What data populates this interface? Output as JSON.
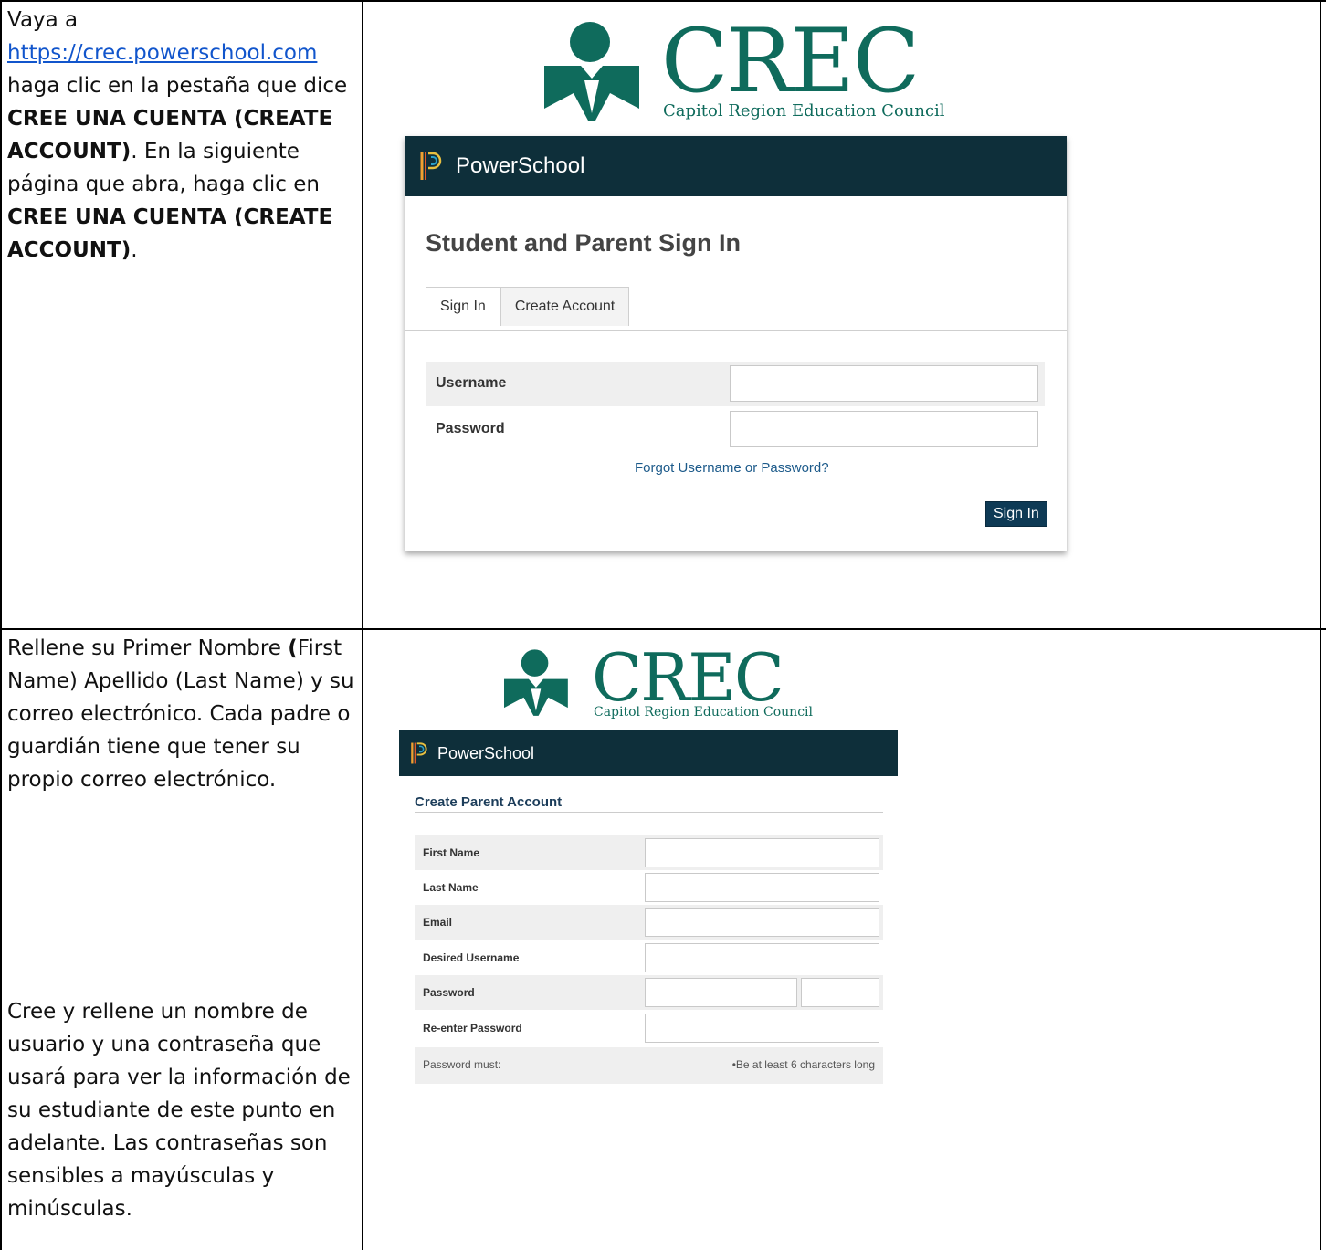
{
  "row1": {
    "instruction": {
      "prefix": "Vaya a",
      "link": "https://crec.powerschool.com",
      "text1": " haga clic en la pestaña que dice ",
      "bold1": "CREE UNA CUENTA (CREATE ACCOUNT)",
      "text2": ". En la siguiente página  que abra, haga clic en ",
      "bold2": "CREE UNA CUENTA (CREATE ACCOUNT)",
      "text3": "."
    },
    "logo": {
      "word": "CREC",
      "subtitle": "Capitol Region Education Council"
    },
    "powerschool": {
      "brand": "PowerSchool",
      "title": "Student and Parent Sign In",
      "tabs": [
        "Sign In",
        "Create Account"
      ],
      "fields": [
        {
          "label": "Username",
          "value": ""
        },
        {
          "label": "Password",
          "value": ""
        }
      ],
      "forgot": "Forgot Username or Password?",
      "signin": "Sign In"
    }
  },
  "row2": {
    "instruction1": {
      "text1": "Rellene su Primer Nombre ",
      "bold1": "(",
      "text2": "First Name) Apellido (Last Name) y su correo electrónico.  Cada padre o guardián tiene que tener su propio correo electrónico."
    },
    "instruction2": "Cree y rellene un nombre de usuario y una contraseña que usará para ver la información de su estudiante de este punto en adelante.  Las contraseñas son sensibles a mayúsculas y minúsculas.",
    "logo": {
      "word": "CREC",
      "subtitle": "Capitol Region Education Council"
    },
    "powerschool": {
      "brand": "PowerSchool",
      "title": "Create Parent Account",
      "fields": [
        {
          "label": "First Name"
        },
        {
          "label": "Last Name"
        },
        {
          "label": "Email"
        },
        {
          "label": "Desired Username"
        },
        {
          "label": "Password"
        },
        {
          "label": "Re-enter Password"
        }
      ],
      "rule_label": "Password must:",
      "rule_text": "•Be at least 6 characters long"
    }
  },
  "colors": {
    "teal": "#0f6b5c",
    "header": "#0e2f3a",
    "link": "#1155cc"
  }
}
